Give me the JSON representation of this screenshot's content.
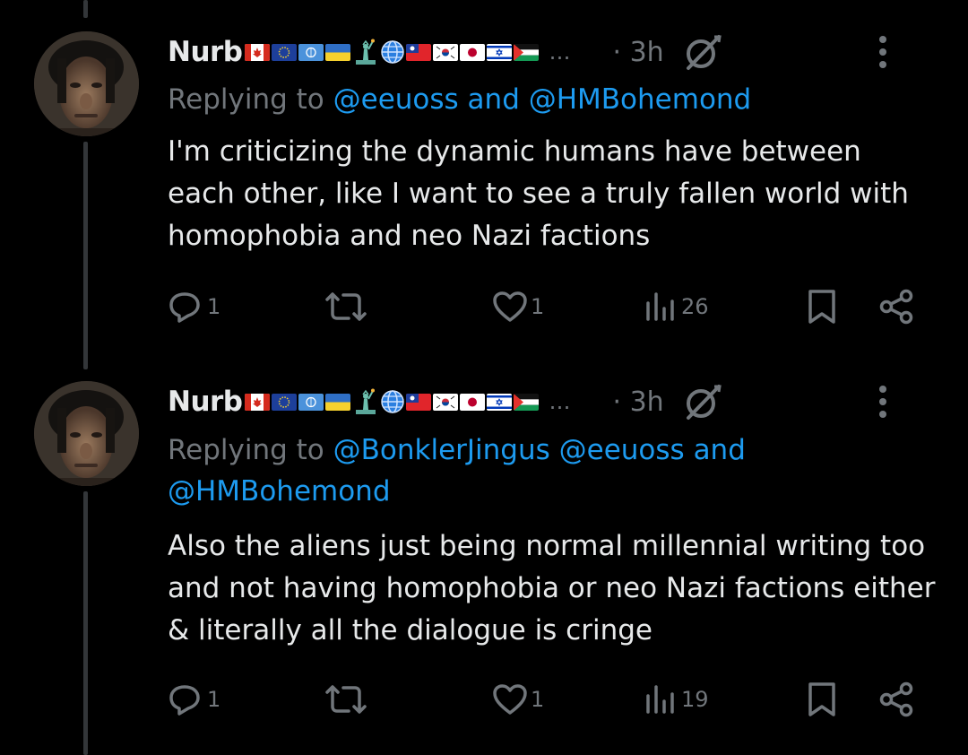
{
  "thread": {
    "tweets": [
      {
        "author": {
          "name": "Nurb"
        },
        "more_label": "…",
        "time": "· 3h",
        "replying": {
          "prefix": "Replying to ",
          "mentions": [
            "@eeuoss",
            "and",
            "@HMBohemond"
          ]
        },
        "text": "I'm criticizing the dynamic humans have between each other, like I want to see a truly fallen world with homophobia and neo Nazi factions",
        "stats": {
          "replies": "1",
          "likes": "1",
          "views": "26"
        }
      },
      {
        "author": {
          "name": "Nurb"
        },
        "more_label": "…",
        "time": "· 3h",
        "replying": {
          "prefix": "Replying to ",
          "mentions": [
            "@BonklerJingus",
            "@eeuoss",
            "and",
            "@HMBohemond"
          ]
        },
        "text": "Also the aliens just being normal millennial writing too and not having homophobia or neo Nazi factions either & literally all the dialogue is cringe",
        "stats": {
          "replies": "1",
          "likes": "1",
          "views": "19"
        }
      }
    ]
  },
  "flags": [
    "canada-flag",
    "eu-flag",
    "un-flag",
    "ukraine-flag",
    "statue-of-liberty-emoji",
    "globe-emoji",
    "taiwan-flag",
    "south-korea-flag",
    "japan-flag",
    "israel-flag",
    "palestine-flag"
  ],
  "colors": {
    "background": "#000000",
    "text": "#e7e9ea",
    "secondary": "#71767b",
    "link": "#1d9bf0",
    "thread_line": "#333639"
  }
}
